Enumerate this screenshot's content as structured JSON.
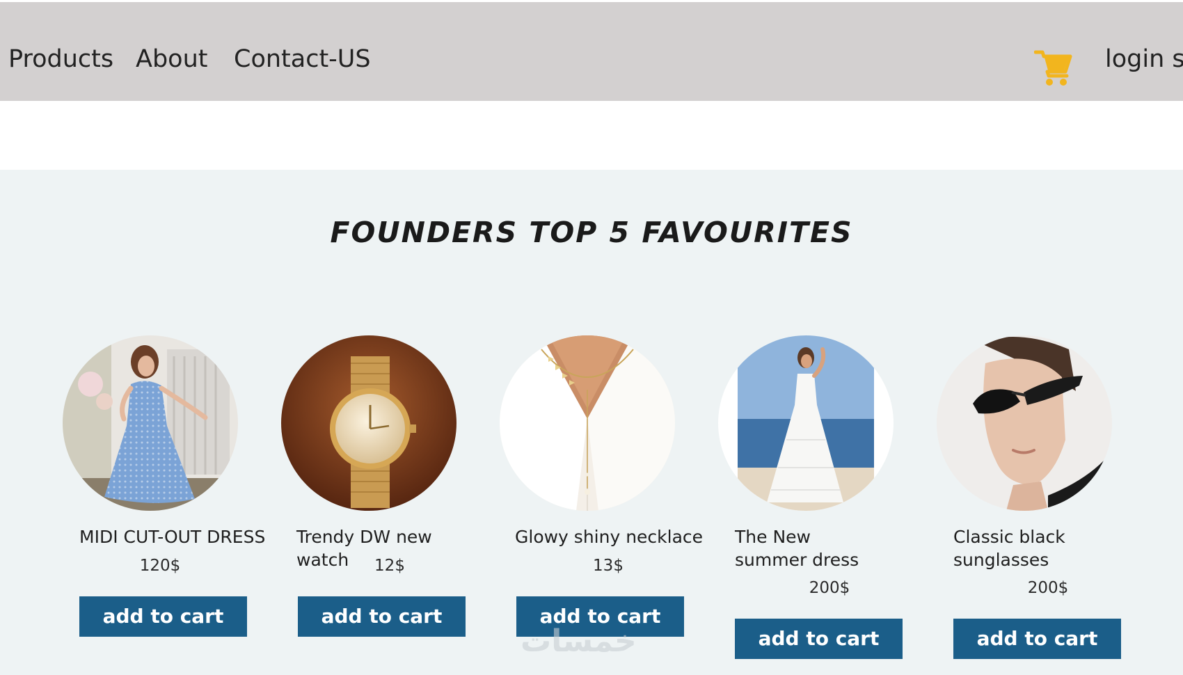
{
  "nav": {
    "links": [
      "Products",
      "About",
      "Contact-US"
    ],
    "cart_icon": "shopping-cart-icon",
    "login_label": "login si"
  },
  "section": {
    "title": "FOUNDERS TOP 5 FAVOURITES"
  },
  "products": [
    {
      "name": "MIDI CUT-OUT DRESS",
      "price": "120$",
      "button": "add to cart"
    },
    {
      "name": "Trendy DW new watch",
      "price": "12$",
      "button": "add to cart"
    },
    {
      "name": "Glowy shiny necklace",
      "price": "13$",
      "button": "add to cart"
    },
    {
      "name": "The New summer dress",
      "price": "200$",
      "button": "add to cart"
    },
    {
      "name": "Classic black sunglasses",
      "price": "200$",
      "button": "add to cart"
    }
  ],
  "colors": {
    "nav_bg": "#d3d0d0",
    "section_bg": "#eef3f4",
    "button_bg": "#1b5e89",
    "cart_icon": "#f2b51e"
  },
  "watermark": "خمسات"
}
